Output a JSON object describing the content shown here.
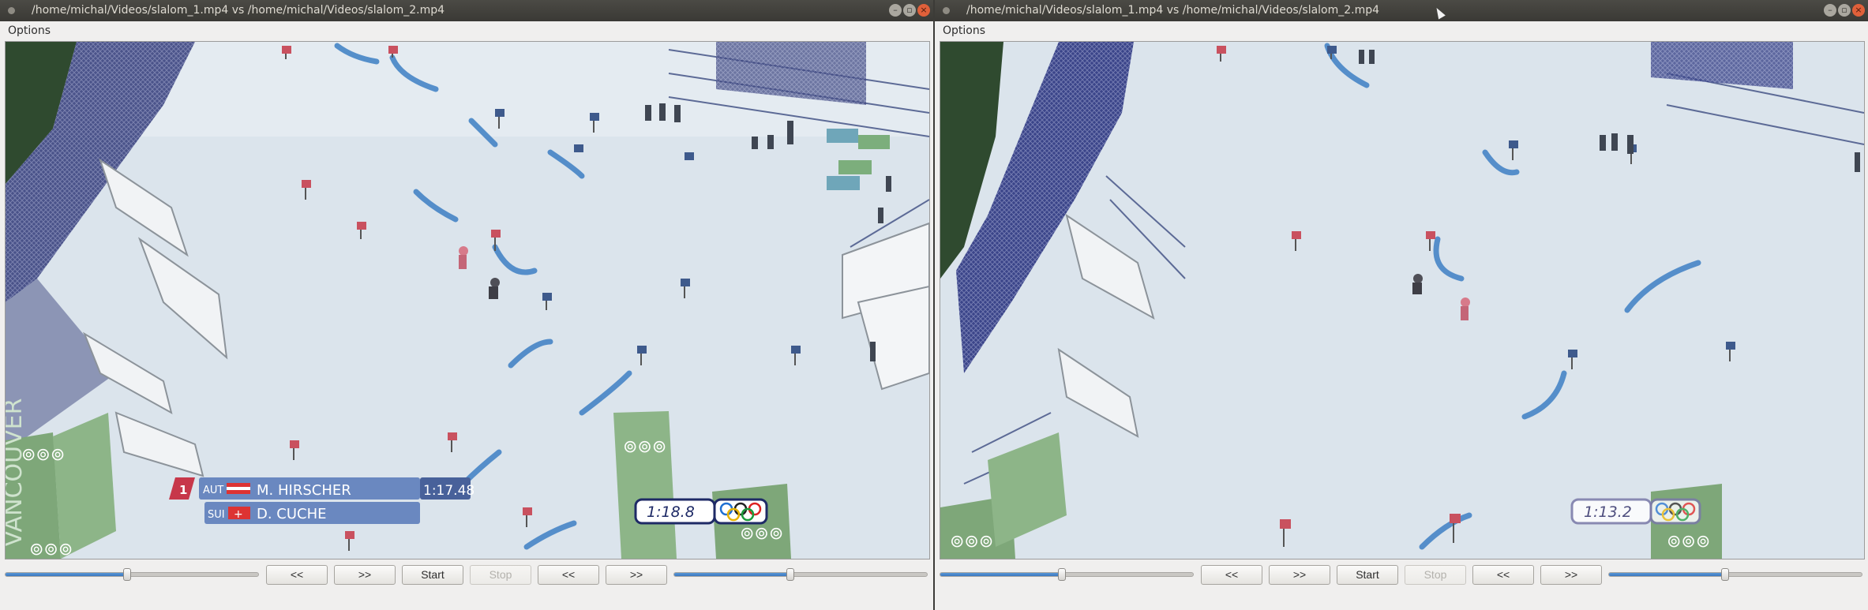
{
  "windows": [
    {
      "title": "/home/michal/Videos/slalom_1.mp4   vs   /home/michal/Videos/slalom_2.mp4",
      "menu": "Options",
      "overlay": {
        "rank": "1",
        "row1_country": "AUT",
        "row1_name": "M. HIRSCHER",
        "row1_time": "1:17.48",
        "row2_country": "SUI",
        "row2_name": "D. CUCHE",
        "timer": "1:18.8",
        "watermark": "VANCOUVER"
      },
      "controls": {
        "left_slider_value": 0.48,
        "right_slider_value": 0.46,
        "buttons": [
          "<<",
          ">>",
          "Start",
          "Stop",
          "<<",
          ">>"
        ],
        "stop_disabled": true
      }
    },
    {
      "title": "/home/michal/Videos/slalom_1.mp4   vs   /home/michal/Videos/slalom_2.mp4",
      "menu": "Options",
      "overlay": {
        "timer": "1:13.2"
      },
      "controls": {
        "left_slider_value": 0.48,
        "right_slider_value": 0.46,
        "buttons": [
          "<<",
          ">>",
          "Start",
          "Stop",
          "<<",
          ">>"
        ],
        "stop_disabled": true
      }
    }
  ],
  "colors": {
    "titlebar": "#3c3b37",
    "close_button": "#e0603a",
    "slider_fill": "#4a88cc",
    "snow": "#d8e2ea",
    "netting": "#2d3470"
  },
  "icons": [
    "window-menu-icon",
    "minimize-icon",
    "maximize-icon",
    "close-icon",
    "olympic-rings-icon",
    "mouse-cursor-icon"
  ]
}
